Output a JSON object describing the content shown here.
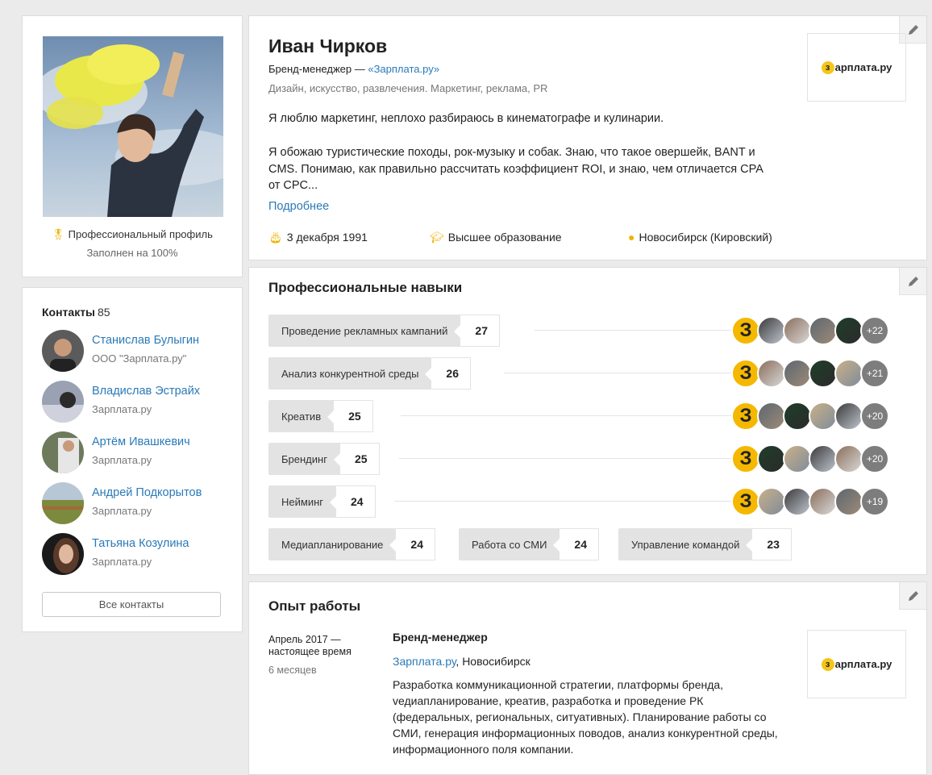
{
  "profile_card": {
    "pro_label": "Профессиональный профиль",
    "filled_label": "Заполнен на 100%"
  },
  "contacts": {
    "title": "Контакты",
    "count": "85",
    "items": [
      {
        "name": "Станислав Булыгин",
        "company": "ООО \"Зарплата.ру\""
      },
      {
        "name": "Владислав Эстрайх",
        "company": "Зарплата.ру"
      },
      {
        "name": "Артём Ивашкевич",
        "company": "Зарплата.ру"
      },
      {
        "name": "Андрей Подкорытов",
        "company": "Зарплата.ру"
      },
      {
        "name": "Татьяна Козулина",
        "company": "Зарплата.ру"
      }
    ],
    "all_button": "Все контакты"
  },
  "header": {
    "name": "Иван Чирков",
    "position": "Бренд-менеджер — ",
    "company_link": "«Зарплата.ру»",
    "industries": "Дизайн, искусство, развлечения. Маркетинг, реклама, PR",
    "about_1": "Я люблю маркетинг, неплохо разбираюсь в кинематографе и кулинарии.",
    "about_2": "Я обожаю туристические походы, рок-музыку и собак. Знаю, что такое овершейк, BANT и CMS. Понимаю, как правильно рассчитать коэффициент ROI, и знаю, чем отличается CPA от CPC...",
    "more_link": "Подробнее",
    "birthday": "3 декабря 1991",
    "education": "Высшее образование",
    "location": "Новосибирск (Кировский)",
    "logo_text": "арплата.ру",
    "logo_mark": "з"
  },
  "skills": {
    "title": "Профессиональные навыки",
    "items": [
      {
        "label": "Проведение рекламных кампаний",
        "count": "27",
        "more": "+22"
      },
      {
        "label": "Анализ конкурентной среды",
        "count": "26",
        "more": "+21"
      },
      {
        "label": "Креатив",
        "count": "25",
        "more": "+20"
      },
      {
        "label": "Брендинг",
        "count": "25",
        "more": "+20"
      },
      {
        "label": "Нейминг",
        "count": "24",
        "more": "+19"
      }
    ],
    "extra": [
      {
        "label": "Медиапланирование",
        "count": "24"
      },
      {
        "label": "Работа со СМИ",
        "count": "24"
      },
      {
        "label": "Управление командой",
        "count": "23"
      }
    ],
    "endorser_mark": "З"
  },
  "experience": {
    "title": "Опыт работы",
    "date": "Апрель 2017 — настоящее время",
    "duration": "6 месяцев",
    "position": "Бренд-менеджер",
    "company_link": "Зарплата.ру",
    "city": ", Новосибирск",
    "description": "Разработка коммуникационной стратегии, платформы бренда, vедиапланирование, креатив, разработка и проведение РК (федеральных, региональных, ситуативных). Планирование работы со СМИ, генерация информационных поводов, анализ конкурентной среды, информационного поля компании.",
    "logo_text": "арплата.ру",
    "logo_mark": "з"
  },
  "colors": {
    "link": "#2a7ab8",
    "accent": "#f0b400",
    "background": "#ebebeb"
  }
}
